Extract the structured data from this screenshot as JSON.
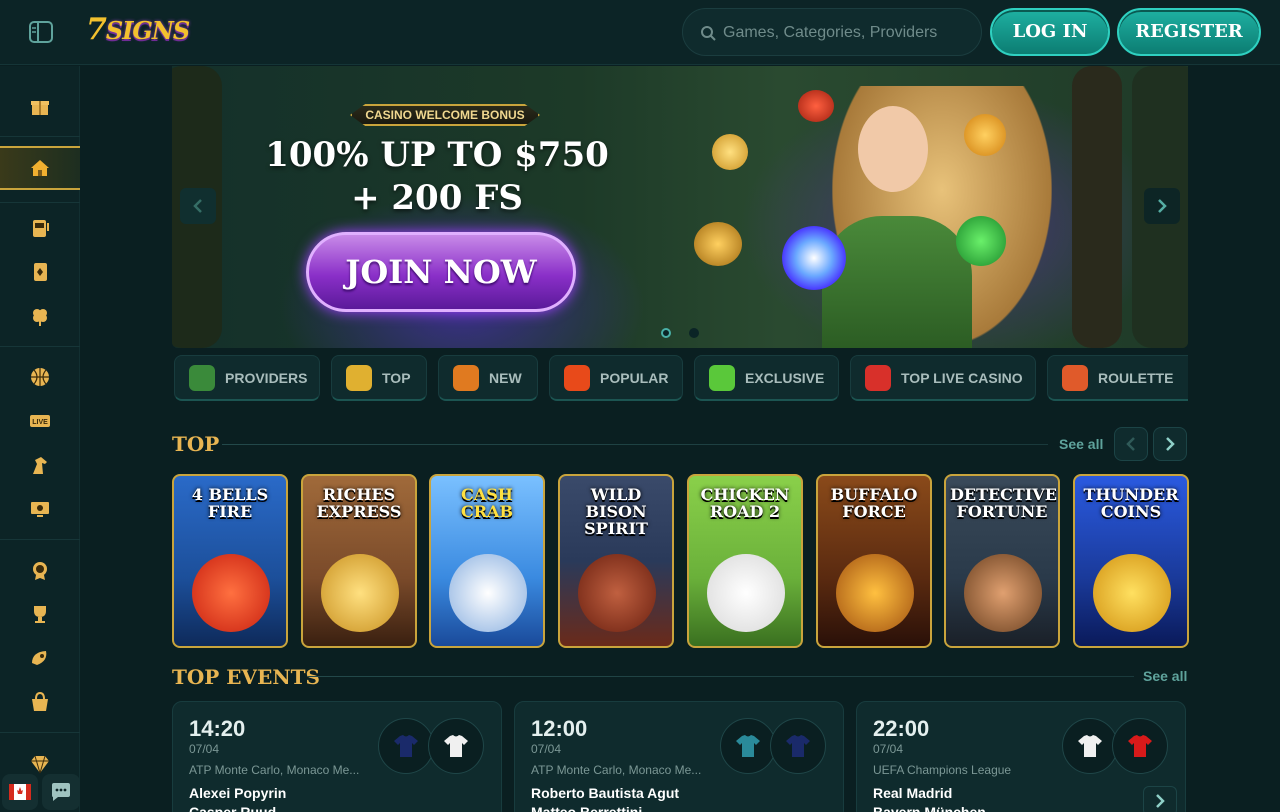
{
  "header": {
    "logo_number": "7",
    "logo_text": "SIGNS",
    "search_placeholder": "Games, Categories, Providers",
    "login_label": "LOG IN",
    "register_label": "REGISTER"
  },
  "sidebar": {
    "icons": [
      "gift-icon",
      "home-icon",
      "slot-machine-icon",
      "cards-icon",
      "clover-icon",
      "basketball-icon",
      "live-icon",
      "horse-icon",
      "esports-icon",
      "medal-icon",
      "trophy-icon",
      "boost-icon",
      "shop-icon",
      "diamond-icon"
    ]
  },
  "banner": {
    "tag": "CASINO WELCOME BONUS",
    "headline_line1": "100% UP TO $750",
    "headline_line2": "+ 200 FS",
    "cta": "JOIN NOW",
    "slide_count": 2,
    "active_slide": 1
  },
  "categories": [
    {
      "label": "PROVIDERS",
      "icon": "book-icon",
      "color": "#3a8a3a"
    },
    {
      "label": "TOP",
      "icon": "crown-icon",
      "color": "#e0b030"
    },
    {
      "label": "NEW",
      "icon": "megaphone-icon",
      "color": "#e07a20"
    },
    {
      "label": "POPULAR",
      "icon": "fire-icon",
      "color": "#e84a1a"
    },
    {
      "label": "EXCLUSIVE",
      "icon": "gem-icon",
      "color": "#5ac83a"
    },
    {
      "label": "TOP LIVE CASINO",
      "icon": "chips-icon",
      "color": "#d8302a"
    },
    {
      "label": "ROULETTE",
      "icon": "roulette-icon",
      "color": "#e05a2a"
    }
  ],
  "top_section": {
    "title": "TOP",
    "see_all": "See all"
  },
  "games": [
    {
      "name": "4 BELLS FIRE",
      "bg": "#1c4f9a",
      "accent": "#e83020"
    },
    {
      "name": "RICHES EXPRESS",
      "bg": "#7a4a2a",
      "accent": "#e0b040"
    },
    {
      "name": "CASH CRAB",
      "bg": "#3a8ae0",
      "accent": "#f0d030"
    },
    {
      "name": "WILD BISON SPIRIT",
      "bg": "#2a3a5a",
      "accent": "#a0402a"
    },
    {
      "name": "CHICKEN ROAD 2",
      "bg": "#6ab03a",
      "accent": "#f0f0f0"
    },
    {
      "name": "BUFFALO FORCE",
      "bg": "#5a2a10",
      "accent": "#f0a020"
    },
    {
      "name": "DETECTIVE FORTUNE",
      "bg": "#2a3a4a",
      "accent": "#c08040"
    },
    {
      "name": "THUNDER COINS",
      "bg": "#1a3a9a",
      "accent": "#f0c020"
    }
  ],
  "events_section": {
    "title": "TOP EVENTS",
    "see_all": "See all"
  },
  "events": [
    {
      "time": "14:20",
      "date": "07/04",
      "league": "ATP Monte Carlo, Monaco Me...",
      "team1": "Alexei Popyrin",
      "team2": "Casper Ruud",
      "jersey1": "#1a2a6a",
      "jersey2": "#f0f0f0"
    },
    {
      "time": "12:00",
      "date": "07/04",
      "league": "ATP Monte Carlo, Monaco Me...",
      "team1": "Roberto Bautista Agut",
      "team2": "Matteo Berrettini",
      "jersey1": "#2a8a9a",
      "jersey2": "#1a2a6a"
    },
    {
      "time": "22:00",
      "date": "07/04",
      "league": "UEFA Champions League",
      "team1": "Real Madrid",
      "team2": "Bayern München",
      "jersey1": "#f0f0f0",
      "jersey2": "#d81a1a"
    }
  ]
}
